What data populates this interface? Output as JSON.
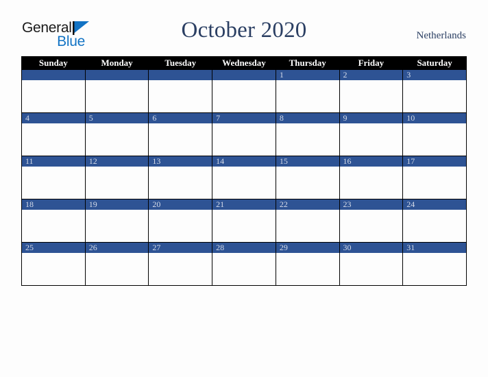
{
  "logo": {
    "line1": "General",
    "line2": "Blue",
    "triangle_color": "#1273c4",
    "text_color": "#1a1a1a",
    "blue_color": "#1273c4"
  },
  "header": {
    "title": "October 2020",
    "country": "Netherlands",
    "title_color": "#2b3f63"
  },
  "calendar": {
    "weekday_headers": [
      "Sunday",
      "Monday",
      "Tuesday",
      "Wednesday",
      "Thursday",
      "Friday",
      "Saturday"
    ],
    "header_bg": "#000000",
    "header_text": "#ffffff",
    "daynum_bg": "#2e5394",
    "daynum_text": "#d6dce9",
    "weeks": [
      [
        "",
        "",
        "",
        "",
        "1",
        "2",
        "3"
      ],
      [
        "4",
        "5",
        "6",
        "7",
        "8",
        "9",
        "10"
      ],
      [
        "11",
        "12",
        "13",
        "14",
        "15",
        "16",
        "17"
      ],
      [
        "18",
        "19",
        "20",
        "21",
        "22",
        "23",
        "24"
      ],
      [
        "25",
        "26",
        "27",
        "28",
        "29",
        "30",
        "31"
      ]
    ]
  }
}
